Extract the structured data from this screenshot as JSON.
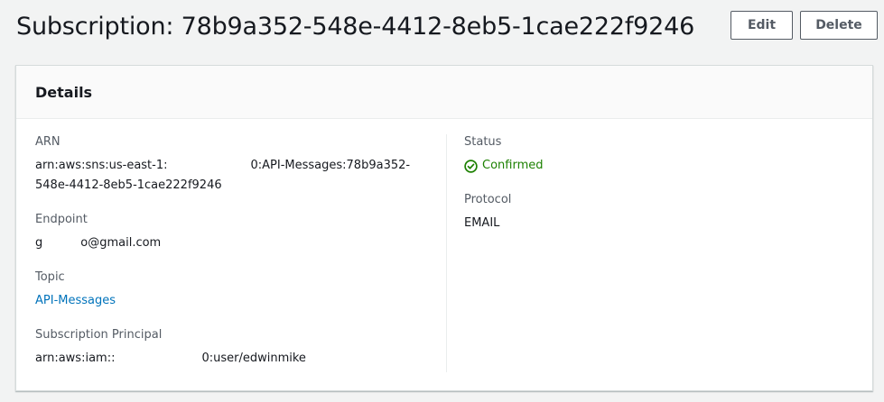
{
  "header": {
    "title": "Subscription: 78b9a352-548e-4412-8eb5-1cae222f9246",
    "edit_label": "Edit",
    "delete_label": "Delete"
  },
  "details": {
    "title": "Details",
    "arn_label": "ARN",
    "arn_value": "arn:aws:sns:us-east-1:",
    "arn_value_suffix": "0:API-Messages:78b9a352-548e-4412-8eb5-1cae222f9246",
    "endpoint_label": "Endpoint",
    "endpoint_value_prefix": "g",
    "endpoint_value_suffix": "o@gmail.com",
    "topic_label": "Topic",
    "topic_value": "API-Messages",
    "principal_label": "Subscription Principal",
    "principal_value_prefix": "arn:aws:iam::",
    "principal_value_suffix": "0:user/edwinmike",
    "status_label": "Status",
    "status_value": "Confirmed",
    "protocol_label": "Protocol",
    "protocol_value": "EMAIL"
  },
  "colors": {
    "status_green": "#1d8102",
    "link_blue": "#0073bb"
  },
  "icons": {
    "status": "check-circle-icon"
  }
}
